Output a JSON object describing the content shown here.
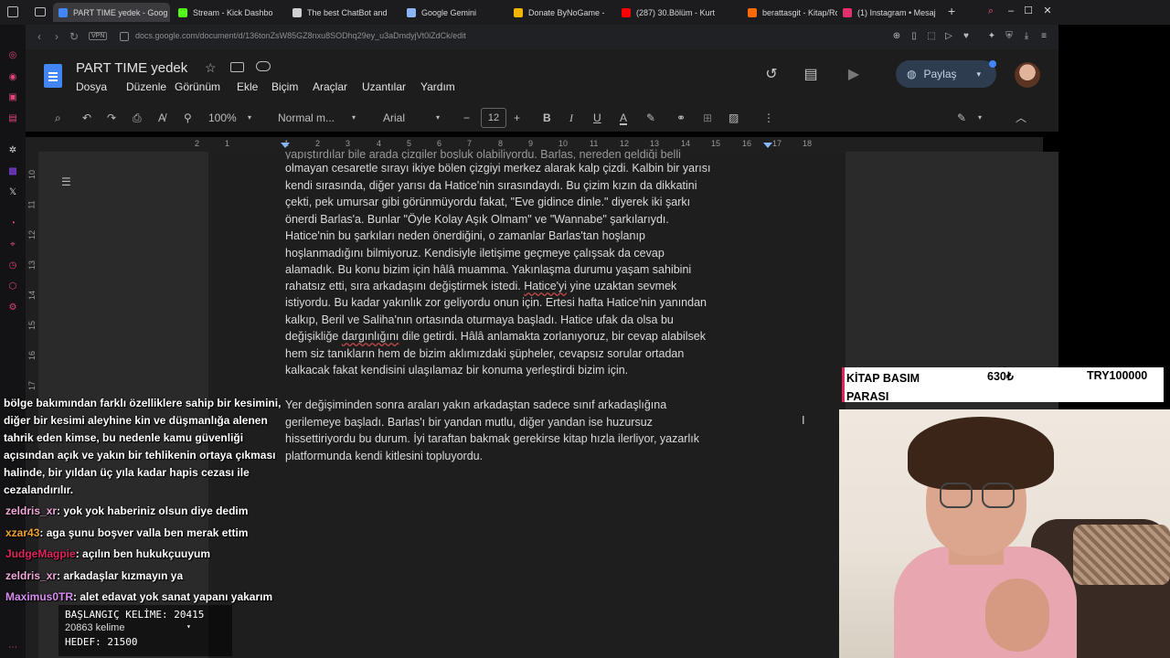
{
  "browser": {
    "tabs": [
      {
        "label": "PART TIME yedek - Goog",
        "color": "#4285f4",
        "active": true
      },
      {
        "label": "Stream - Kick Dashbo",
        "color": "#53fc18"
      },
      {
        "label": "The best ChatBot and",
        "color": "#cfcfcf"
      },
      {
        "label": "Google Gemini",
        "color": "#8ab4f8"
      },
      {
        "label": "Donate ByNoGame -",
        "color": "#f4b400"
      },
      {
        "label": "(287) 30.Bölüm - Kurt",
        "color": "#ff0000"
      },
      {
        "label": "berattasgit - Kitap/Ro",
        "color": "#ff6a00"
      },
      {
        "label": "(1) Instagram • Mesaj",
        "color": "#e1306c"
      }
    ],
    "vpn": "VPN",
    "url": "docs.google.com/document/d/136tonZsW85GZ8nxu8SODhq29ey_u3aDmdyjVt0iZdCk/edit"
  },
  "docs": {
    "title": "PART TIME yedek",
    "menu": [
      "Dosya",
      "Düzenle",
      "Görünüm",
      "Ekle",
      "Biçim",
      "Araçlar",
      "Uzantılar",
      "Yardım"
    ],
    "share_label": "Paylaş",
    "zoom": "100%",
    "style": "Normal m...",
    "font": "Arial",
    "font_size": "12"
  },
  "ruler": [
    "2",
    "1",
    "1",
    "2",
    "3",
    "4",
    "5",
    "6",
    "7",
    "8",
    "9",
    "10",
    "11",
    "12",
    "13",
    "14",
    "15",
    "16",
    "17",
    "18"
  ],
  "vruler": [
    "10",
    "11",
    "12",
    "13",
    "14",
    "15",
    "16",
    "17"
  ],
  "content": {
    "p1_top": "yapıştırdılar bile arada çizgiler boşluk olabiliyordu. Barlas, nereden geldiği belli",
    "p1_lines": [
      "olmayan cesaretle sırayı ikiye bölen çizgiyi merkez alarak kalp çizdi. Kalbin bir yarısı",
      "kendi sırasında, diğer yarısı da Hatice'nin sırasındaydı. Bu çizim kızın da dikkatini",
      "çekti, pek umursar gibi görünmüyordu fakat, \"Eve gidince dinle.\" diyerek iki şarkı",
      "önerdi Barlas'a. Bunlar \"Öyle Kolay Aşık Olmam\" ve \"Wannabe\" şarkılarıydı.",
      "Hatice'nin bu şarkıları neden önerdiğini, o zamanlar Barlas'tan hoşlanıp",
      "hoşlanmadığını bilmiyoruz. Kendisiyle iletişime geçmeye çalışsak da cevap",
      "alamadık. Bu konu bizim için hâlâ muamma. Yakınlaşma durumu yaşam sahibini"
    ],
    "p1_l8_a": "rahatsız etti, sıra arkadaşını değiştirmek istedi. ",
    "p1_l8_err": "Hatice'yi",
    "p1_l8_b": " yine uzaktan sevmek",
    "p1_l9": "istiyordu. Bu kadar yakınlık zor geliyordu onun için. Ertesi hafta Hatice'nin yanından",
    "p1_l10": "kalkıp, Beril ve Saliha'nın ortasında oturmaya başladı. Hatice ufak da olsa bu",
    "p1_l11_a": "değişikliğe ",
    "p1_l11_err": "dargınlığını",
    "p1_l11_b": " dile getirdi. Hâlâ anlamakta zorlanıyoruz, bir cevap alabilsek",
    "p1_l12": "hem siz tanıkların hem de bizim aklımızdaki şüpheler, cevapsız sorular ortadan",
    "p1_l13": "kalkacak fakat kendisini ulaşılamaz bir konuma yerleştirdi bizim için.",
    "p2_lines": [
      "Yer değişiminden sonra araları yakın arkadaştan sadece sınıf arkadaşlığına",
      "gerilemeye başladı. Barlas'ı bir yandan mutlu, diğer yandan ise huzursuz",
      "hissettiriyordu bu durum. İyi taraftan bakmak gerekirse kitap hızla ilerliyor, yazarlık",
      "platformunda kendi kitlesini topluyordu."
    ]
  },
  "chat": {
    "legal": "bölge bakımından farklı özelliklere sahip bir kesimini, diğer bir kesimi aleyhine kin ve düşmanlığa alenen tahrik eden kimse, bu nedenle kamu güvenliği açısından açık ve yakın bir tehlikenin ortaya çıkması halinde, bir yıldan üç yıla kadar hapis cezası ile cezalandırılır.",
    "messages": [
      {
        "user": "zeldris_xr",
        "color": "#f2a7d8",
        "text": ": yok yok haberiniz olsun diye dedim"
      },
      {
        "user": "xzar43",
        "color": "#f0a030",
        "text": ": aga şunu boşver valla ben merak ettim"
      },
      {
        "user": "JudgeMagpie",
        "color": "#e0245e",
        "text": ": açılın ben hukukçuuyum"
      },
      {
        "user": "zeldris_xr",
        "color": "#f2a7d8",
        "text": ": arkadaşlar kızmayın ya"
      },
      {
        "user": "Maximus0TR",
        "color": "#d88cf0",
        "text": ": alet edavat yok sanat yapanı yakarım"
      }
    ]
  },
  "counter": {
    "start": "BAŞLANGIÇ KELİME: 20415",
    "words": "20863 kelime",
    "target": "HEDEF: 21500"
  },
  "overlay": {
    "label": "KİTAP BASIM PARASI",
    "amount": "630₺",
    "goal": "TRY100000"
  }
}
